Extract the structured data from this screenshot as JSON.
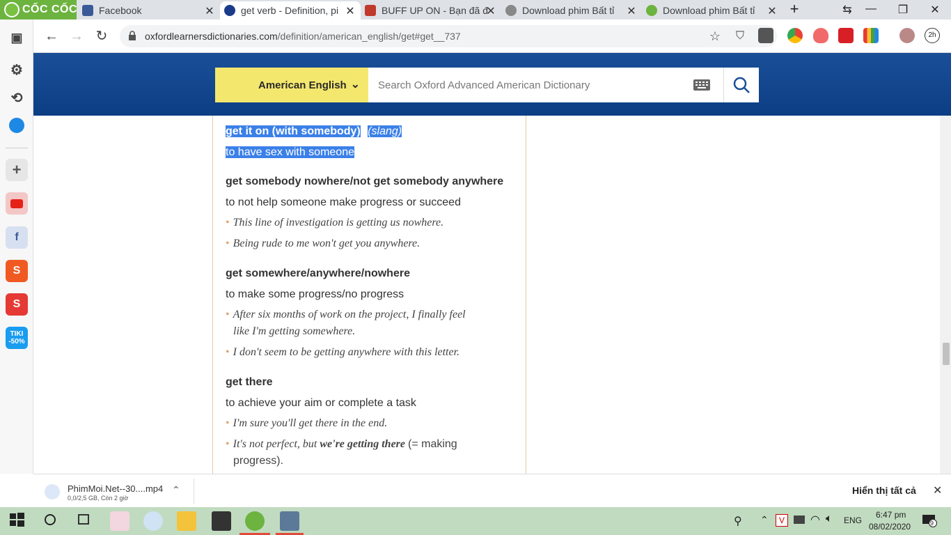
{
  "browser": {
    "brand": "CỐC CỐC",
    "tabs": [
      {
        "title": "Facebook"
      },
      {
        "title": "get verb - Definition, pi"
      },
      {
        "title": "BUFF UP ON - Bạn đã đ"
      },
      {
        "title": "Download phim Bất tỉ"
      },
      {
        "title": "Download phim Bất tỉ"
      }
    ],
    "new_tab": "+",
    "url_host": "oxfordlearnersdictionaries.com",
    "url_path": "/definition/american_english/get#get__737",
    "profile_badge": "2h"
  },
  "site": {
    "dict_selector": "American English",
    "search_placeholder": "Search Oxford Advanced American Dictionary"
  },
  "entry": {
    "idioms": [
      {
        "head": "get it on (with somebody)",
        "label": "slang",
        "def": "to have sex with someone"
      },
      {
        "head": "get somebody nowhere/not get somebody anywhere",
        "def": "to not help someone make progress or succeed",
        "examples": [
          "This line of investigation is getting us nowhere.",
          "Being rude to me won't get you anywhere."
        ]
      },
      {
        "head": "get somewhere/anywhere/nowhere",
        "def": "to make some progress/no progress",
        "examples": [
          "After six months of work on the project, I finally feel",
          "like I'm getting somewhere.",
          "I don't seem to be getting anywhere with this letter."
        ]
      },
      {
        "head": "get there",
        "def": "to achieve your aim or complete a task",
        "examples": [
          "I'm sure you'll get there in the end.",
          "It's not perfect, but",
          "we're getting there",
          "(= making",
          "progress)."
        ]
      }
    ]
  },
  "download": {
    "filename": "PhimMoi.Net--30....mp4",
    "status": "0,0/2,5 GB, Còn 2 giờ",
    "show_all": "Hiển thị tất cả"
  },
  "taskbar": {
    "time": "6:47 pm",
    "date": "08/02/2020",
    "lang": "ENG",
    "notif_count": "9"
  }
}
